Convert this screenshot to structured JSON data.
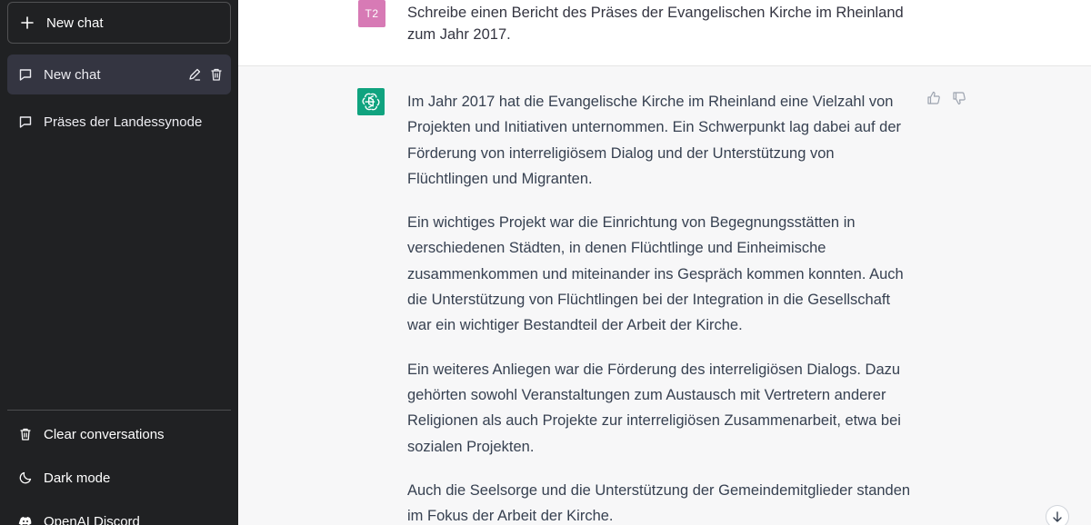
{
  "sidebar": {
    "new_chat_label": "New chat",
    "conversations": [
      {
        "label": "New chat",
        "active": true
      },
      {
        "label": "Präses der Landessynode",
        "active": false
      }
    ],
    "bottom": {
      "clear_label": "Clear conversations",
      "dark_mode_label": "Dark mode",
      "discord_label": "OpenAI Discord"
    }
  },
  "thread": {
    "user": {
      "avatar_initials": "T2",
      "text": "Schreibe einen Bericht des Präses der Evangelischen Kirche im Rheinland zum Jahr 2017."
    },
    "assistant": {
      "paragraphs": [
        "Im Jahr 2017 hat die Evangelische Kirche im Rheinland eine Vielzahl von Projekten und Initiativen unternommen. Ein Schwerpunkt lag dabei auf der Förderung von interreligiösem Dialog und der Unterstützung von Flüchtlingen und Migranten.",
        "Ein wichtiges Projekt war die Einrichtung von Begegnungsstätten in verschiedenen Städten, in denen Flüchtlinge und Einheimische zusammenkommen und miteinander ins Gespräch kommen konnten. Auch die Unterstützung von Flüchtlingen bei der Integration in die Gesellschaft war ein wichtiger Bestandteil der Arbeit der Kirche.",
        "Ein weiteres Anliegen war die Förderung des interreligiösen Dialogs. Dazu gehörten sowohl Veranstaltungen zum Austausch mit Vertretern anderer Religionen als auch Projekte zur interreligiösen Zusammenarbeit, etwa bei sozialen Projekten.",
        "Auch die Seelsorge und die Unterstützung der Gemeindemitglieder standen im Fokus der Arbeit der Kirche."
      ]
    }
  },
  "icons": {
    "plus": "plus-icon",
    "chat": "chat-bubble-icon",
    "edit": "pencil-icon",
    "delete": "trash-icon",
    "clear": "trash-icon",
    "dark_mode": "moon-icon",
    "discord": "discord-icon",
    "thumbs_up": "thumbs-up-icon",
    "thumbs_down": "thumbs-down-icon",
    "scroll_down": "arrow-down-icon",
    "assistant_avatar": "openai-logo-icon"
  },
  "colors": {
    "sidebar_bg": "#202123",
    "active_item_bg": "#343541",
    "user_avatar": "#d77ab5",
    "assistant_avatar": "#10a37f",
    "assistant_bg": "#f7f7f8",
    "text": "#343541"
  }
}
